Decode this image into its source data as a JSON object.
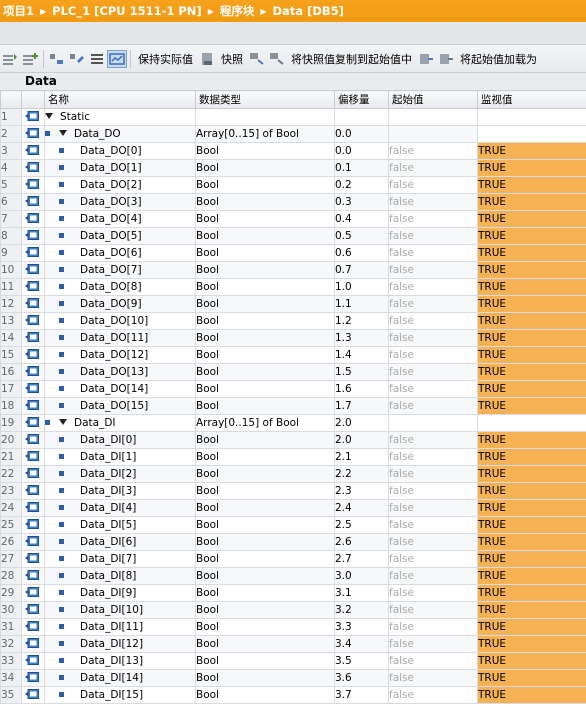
{
  "breadcrumb": [
    "项目1",
    "PLC_1 [CPU 1511-1 PN]",
    "程序块",
    "Data [DB5]"
  ],
  "toolbar": {
    "keep_actual": "保持实际值",
    "snapshot": "快照",
    "copy_snapshot": "将快照值复制到起始值中",
    "load_start": "将起始值加载为"
  },
  "block_name": "Data",
  "columns": {
    "name": "名称",
    "datatype": "数据类型",
    "offset": "偏移量",
    "start": "起始值",
    "monitor": "监视值"
  },
  "rows": [
    {
      "no": "1",
      "name": "Static",
      "type": "",
      "offset": "",
      "start": "",
      "monitor": "",
      "level": 0,
      "expand": true,
      "bullet": false
    },
    {
      "no": "2",
      "name": "Data_DO",
      "type": "Array[0..15] of Bool",
      "offset": "0.0",
      "start": "",
      "monitor": "",
      "level": 1,
      "expand": true,
      "bullet": true
    },
    {
      "no": "3",
      "name": "Data_DO[0]",
      "type": "Bool",
      "offset": "0.0",
      "start": "false",
      "monitor": "TRUE",
      "level": 2,
      "bullet": true
    },
    {
      "no": "4",
      "name": "Data_DO[1]",
      "type": "Bool",
      "offset": "0.1",
      "start": "false",
      "monitor": "TRUE",
      "level": 2,
      "bullet": true
    },
    {
      "no": "5",
      "name": "Data_DO[2]",
      "type": "Bool",
      "offset": "0.2",
      "start": "false",
      "monitor": "TRUE",
      "level": 2,
      "bullet": true
    },
    {
      "no": "6",
      "name": "Data_DO[3]",
      "type": "Bool",
      "offset": "0.3",
      "start": "false",
      "monitor": "TRUE",
      "level": 2,
      "bullet": true
    },
    {
      "no": "7",
      "name": "Data_DO[4]",
      "type": "Bool",
      "offset": "0.4",
      "start": "false",
      "monitor": "TRUE",
      "level": 2,
      "bullet": true
    },
    {
      "no": "8",
      "name": "Data_DO[5]",
      "type": "Bool",
      "offset": "0.5",
      "start": "false",
      "monitor": "TRUE",
      "level": 2,
      "bullet": true
    },
    {
      "no": "9",
      "name": "Data_DO[6]",
      "type": "Bool",
      "offset": "0.6",
      "start": "false",
      "monitor": "TRUE",
      "level": 2,
      "bullet": true
    },
    {
      "no": "10",
      "name": "Data_DO[7]",
      "type": "Bool",
      "offset": "0.7",
      "start": "false",
      "monitor": "TRUE",
      "level": 2,
      "bullet": true
    },
    {
      "no": "11",
      "name": "Data_DO[8]",
      "type": "Bool",
      "offset": "1.0",
      "start": "false",
      "monitor": "TRUE",
      "level": 2,
      "bullet": true
    },
    {
      "no": "12",
      "name": "Data_DO[9]",
      "type": "Bool",
      "offset": "1.1",
      "start": "false",
      "monitor": "TRUE",
      "level": 2,
      "bullet": true
    },
    {
      "no": "13",
      "name": "Data_DO[10]",
      "type": "Bool",
      "offset": "1.2",
      "start": "false",
      "monitor": "TRUE",
      "level": 2,
      "bullet": true
    },
    {
      "no": "14",
      "name": "Data_DO[11]",
      "type": "Bool",
      "offset": "1.3",
      "start": "false",
      "monitor": "TRUE",
      "level": 2,
      "bullet": true
    },
    {
      "no": "15",
      "name": "Data_DO[12]",
      "type": "Bool",
      "offset": "1.4",
      "start": "false",
      "monitor": "TRUE",
      "level": 2,
      "bullet": true
    },
    {
      "no": "16",
      "name": "Data_DO[13]",
      "type": "Bool",
      "offset": "1.5",
      "start": "false",
      "monitor": "TRUE",
      "level": 2,
      "bullet": true
    },
    {
      "no": "17",
      "name": "Data_DO[14]",
      "type": "Bool",
      "offset": "1.6",
      "start": "false",
      "monitor": "TRUE",
      "level": 2,
      "bullet": true
    },
    {
      "no": "18",
      "name": "Data_DO[15]",
      "type": "Bool",
      "offset": "1.7",
      "start": "false",
      "monitor": "TRUE",
      "level": 2,
      "bullet": true
    },
    {
      "no": "19",
      "name": "Data_DI",
      "type": "Array[0..15] of Bool",
      "offset": "2.0",
      "start": "",
      "monitor": "",
      "level": 1,
      "expand": true,
      "bullet": true
    },
    {
      "no": "20",
      "name": "Data_DI[0]",
      "type": "Bool",
      "offset": "2.0",
      "start": "false",
      "monitor": "TRUE",
      "level": 2,
      "bullet": true
    },
    {
      "no": "21",
      "name": "Data_DI[1]",
      "type": "Bool",
      "offset": "2.1",
      "start": "false",
      "monitor": "TRUE",
      "level": 2,
      "bullet": true
    },
    {
      "no": "22",
      "name": "Data_DI[2]",
      "type": "Bool",
      "offset": "2.2",
      "start": "false",
      "monitor": "TRUE",
      "level": 2,
      "bullet": true
    },
    {
      "no": "23",
      "name": "Data_DI[3]",
      "type": "Bool",
      "offset": "2.3",
      "start": "false",
      "monitor": "TRUE",
      "level": 2,
      "bullet": true
    },
    {
      "no": "24",
      "name": "Data_DI[4]",
      "type": "Bool",
      "offset": "2.4",
      "start": "false",
      "monitor": "TRUE",
      "level": 2,
      "bullet": true
    },
    {
      "no": "25",
      "name": "Data_DI[5]",
      "type": "Bool",
      "offset": "2.5",
      "start": "false",
      "monitor": "TRUE",
      "level": 2,
      "bullet": true
    },
    {
      "no": "26",
      "name": "Data_DI[6]",
      "type": "Bool",
      "offset": "2.6",
      "start": "false",
      "monitor": "TRUE",
      "level": 2,
      "bullet": true
    },
    {
      "no": "27",
      "name": "Data_DI[7]",
      "type": "Bool",
      "offset": "2.7",
      "start": "false",
      "monitor": "TRUE",
      "level": 2,
      "bullet": true
    },
    {
      "no": "28",
      "name": "Data_DI[8]",
      "type": "Bool",
      "offset": "3.0",
      "start": "false",
      "monitor": "TRUE",
      "level": 2,
      "bullet": true
    },
    {
      "no": "29",
      "name": "Data_DI[9]",
      "type": "Bool",
      "offset": "3.1",
      "start": "false",
      "monitor": "TRUE",
      "level": 2,
      "bullet": true
    },
    {
      "no": "30",
      "name": "Data_DI[10]",
      "type": "Bool",
      "offset": "3.2",
      "start": "false",
      "monitor": "TRUE",
      "level": 2,
      "bullet": true
    },
    {
      "no": "31",
      "name": "Data_DI[11]",
      "type": "Bool",
      "offset": "3.3",
      "start": "false",
      "monitor": "TRUE",
      "level": 2,
      "bullet": true
    },
    {
      "no": "32",
      "name": "Data_DI[12]",
      "type": "Bool",
      "offset": "3.4",
      "start": "false",
      "monitor": "TRUE",
      "level": 2,
      "bullet": true
    },
    {
      "no": "33",
      "name": "Data_DI[13]",
      "type": "Bool",
      "offset": "3.5",
      "start": "false",
      "monitor": "TRUE",
      "level": 2,
      "bullet": true
    },
    {
      "no": "34",
      "name": "Data_DI[14]",
      "type": "Bool",
      "offset": "3.6",
      "start": "false",
      "monitor": "TRUE",
      "level": 2,
      "bullet": true
    },
    {
      "no": "35",
      "name": "Data_DI[15]",
      "type": "Bool",
      "offset": "3.7",
      "start": "false",
      "monitor": "TRUE",
      "level": 2,
      "bullet": true
    }
  ],
  "colors": {
    "title_bar": "#f29a12",
    "monitor_cell": "#f7b256",
    "interface_icon": "#2f6fbf"
  }
}
